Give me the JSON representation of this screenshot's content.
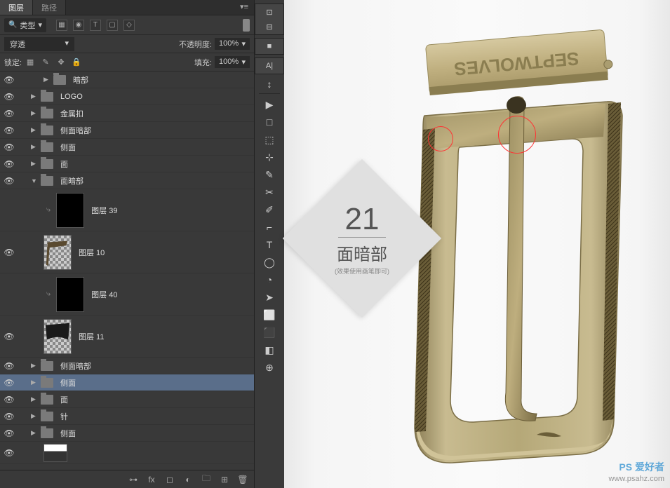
{
  "panel": {
    "tabs": {
      "layers": "图层",
      "paths": "路径"
    },
    "kind_label": "类型",
    "filter_icons": [
      "▦",
      "◉",
      "T",
      "▢",
      "◇"
    ],
    "blend_mode": "穿透",
    "opacity_label": "不透明度:",
    "opacity_value": "100%",
    "lock_label": "锁定:",
    "fill_label": "填充:",
    "fill_value": "100%"
  },
  "layers": {
    "g0": "暗部",
    "g1": "LOGO",
    "g2": "金属扣",
    "g3": "侧面暗部",
    "g4": "侧面",
    "g5": "面",
    "g6": "面暗部",
    "l39": "图层 39",
    "l10": "图层 10",
    "l40": "图层 40",
    "l11": "图层 11",
    "g7": "侧面暗部",
    "g8": "侧面",
    "g9": "面",
    "g10": "针",
    "g11": "侧面"
  },
  "toolbar": {
    "tools": [
      "↕",
      "▶",
      "□",
      "⬚",
      "⊹",
      "✎",
      "✂",
      "✐",
      "⌐",
      "T",
      "◯",
      "◔",
      "➤",
      "⬜",
      "⬛",
      "◧",
      "⊕"
    ],
    "toggles": [
      "⊡",
      "⊟",
      "■",
      "A|"
    ]
  },
  "step": {
    "number": "21",
    "title": "面暗部",
    "note": "(效果使用画笔即可)"
  },
  "product": {
    "brand": "SEPTWOLVES"
  },
  "watermark": {
    "brand": "PS 爱好者",
    "url": "www.psahz.com"
  }
}
